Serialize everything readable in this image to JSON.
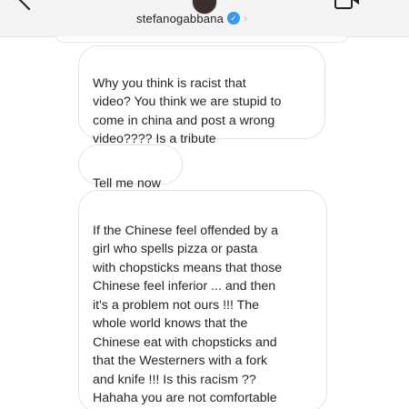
{
  "header": {
    "username": "stefanogabbana",
    "verified_icon": "verified-badge-icon",
    "chevron_icon": "chevron-right-icon",
    "back_icon": "chevron-left-icon",
    "video_icon": "video-call-icon",
    "verified_glyph": "✓",
    "chevron_glyph": "›"
  },
  "messages": [
    {
      "text": "Why you think is racist that\nvideo? You think we are stupid to\ncome in china and post a wrong\nvideo???? Is a tribute"
    },
    {
      "text": "Tell me now"
    },
    {
      "text": "If the Chinese feel offended by a\ngirl who spells pizza or pasta\nwith chopsticks means that those\nChinese feel inferior ... and then\nit's a problem not ours  !!! The\nwhole world knows that the\nChinese eat with chopsticks and\nthat the Westerners with a fork\nand knife !!! Is this racism ??\nHahaha you are not comfortable\nwith the brain"
    }
  ],
  "colors": {
    "header_bg": "#f3f3f3",
    "bubble_border": "#e3e3e3",
    "text": "#262626",
    "verified": "#3897f0"
  }
}
